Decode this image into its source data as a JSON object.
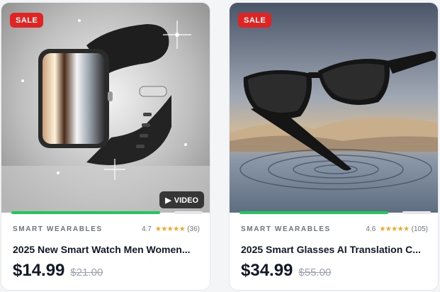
{
  "products": [
    {
      "badge": "SALE",
      "video_label": "VIDEO",
      "category": "SMART WEARABLES",
      "rating": "4.7",
      "stars": "★★★★★",
      "reviews": "(36)",
      "title": "2025 New Smart Watch Men Women...",
      "price": "$14.99",
      "old_price": "$21.00"
    },
    {
      "badge": "SALE",
      "category": "SMART WEARABLES",
      "rating": "4.6",
      "stars": "★★★★★",
      "reviews": "(105)",
      "title": "2025 Smart Glasses AI Translation C...",
      "price": "$34.99",
      "old_price": "$55.00"
    }
  ],
  "colors": {
    "sale": "#e02424",
    "star": "#f5a524",
    "accent": "#22c55e"
  },
  "icons": [
    "play-icon",
    "star-icon"
  ]
}
